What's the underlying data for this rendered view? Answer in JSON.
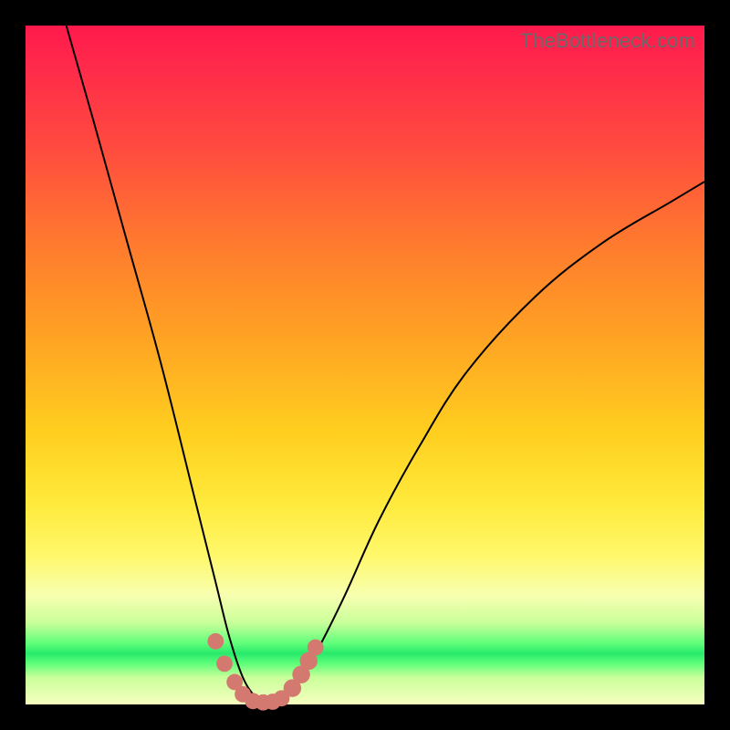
{
  "watermark": "TheBottleneck.com",
  "colors": {
    "frame": "#000000",
    "gradient_top": "#ff1a4d",
    "gradient_mid": "#ffe93a",
    "gradient_green": "#27e96a",
    "curve": "#000000",
    "markers": "#d4796f"
  },
  "chart_data": {
    "type": "line",
    "title": "",
    "xlabel": "",
    "ylabel": "",
    "xlim": [
      0,
      100
    ],
    "ylim": [
      0,
      100
    ],
    "grid": false,
    "legend": false,
    "note": "V-shaped curve with minimum near x≈35; y≈0 at the trough, rising steeply toward both edges. Values estimated from pixels; no axis ticks visible.",
    "series": [
      {
        "name": "curve",
        "x": [
          6,
          10,
          15,
          20,
          25,
          28,
          30,
          32,
          34,
          36,
          38,
          40,
          43,
          47,
          52,
          58,
          65,
          75,
          85,
          95,
          100
        ],
        "y": [
          100,
          86,
          68,
          50,
          30,
          18,
          10,
          4,
          1,
          0,
          1,
          3,
          8,
          16,
          27,
          38,
          49,
          60,
          68,
          74,
          77
        ]
      }
    ],
    "markers": [
      {
        "x": 28.0,
        "y": 9.3,
        "r": 1.2
      },
      {
        "x": 29.3,
        "y": 6.0,
        "r": 1.2
      },
      {
        "x": 30.8,
        "y": 3.3,
        "r": 1.2
      },
      {
        "x": 32.0,
        "y": 1.5,
        "r": 1.2
      },
      {
        "x": 33.5,
        "y": 0.5,
        "r": 1.2
      },
      {
        "x": 35.0,
        "y": 0.3,
        "r": 1.2
      },
      {
        "x": 36.4,
        "y": 0.4,
        "r": 1.2
      },
      {
        "x": 37.7,
        "y": 0.9,
        "r": 1.2
      },
      {
        "x": 39.3,
        "y": 2.4,
        "r": 1.4
      },
      {
        "x": 40.6,
        "y": 4.4,
        "r": 1.4
      },
      {
        "x": 41.7,
        "y": 6.4,
        "r": 1.4
      },
      {
        "x": 42.7,
        "y": 8.4,
        "r": 1.2
      }
    ]
  }
}
